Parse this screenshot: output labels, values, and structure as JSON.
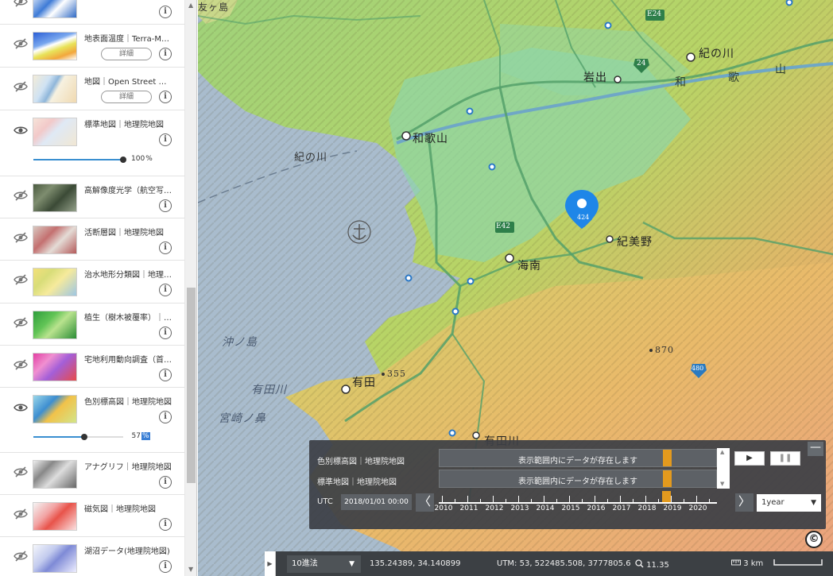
{
  "layers": [
    {
      "name": "",
      "visible": false,
      "detail_button": "",
      "has_slider": false
    },
    {
      "name": "地表面温度｜Terra-MODIS",
      "visible": false,
      "detail_button": "詳細",
      "has_slider": false
    },
    {
      "name": "地図｜Open Street Map",
      "visible": false,
      "detail_button": "詳細",
      "has_slider": false
    },
    {
      "name": "標準地図｜地理院地図",
      "visible": true,
      "detail_button": "",
      "has_slider": true,
      "opacity": "100",
      "opacity_unit": "%"
    },
    {
      "name": "高解像度光学（航空写真）",
      "visible": false,
      "detail_button": "",
      "has_slider": false
    },
    {
      "name": "活断層図｜地理院地図",
      "visible": false,
      "detail_button": "",
      "has_slider": false
    },
    {
      "name": "治水地形分類図｜地理院地図",
      "visible": false,
      "detail_button": "",
      "has_slider": false
    },
    {
      "name": "植生（樹木被覆率）｜…",
      "visible": false,
      "detail_button": "",
      "has_slider": false
    },
    {
      "name": "宅地利用動向調査（首都圏）",
      "visible": false,
      "detail_button": "",
      "has_slider": false
    },
    {
      "name": "色別標高図｜地理院地図",
      "visible": true,
      "detail_button": "",
      "has_slider": true,
      "opacity": "57",
      "opacity_unit": "%"
    },
    {
      "name": "アナグリフ｜地理院地図",
      "visible": false,
      "detail_button": "",
      "has_slider": false
    },
    {
      "name": "磁気図｜地理院地図",
      "visible": false,
      "detail_button": "",
      "has_slider": false
    },
    {
      "name": "湖沼データ(地理院地図)",
      "visible": false,
      "detail_button": "",
      "has_slider": false
    }
  ],
  "map": {
    "labels": {
      "kinokawa_sea": "紀の川",
      "wakayama": "和歌山",
      "iwade": "岩出",
      "kinokawa_city": "紀の川",
      "kimino": "紀美野",
      "kainan": "海南",
      "okinoshima": "沖ノ島",
      "aridagawa": "有田川",
      "arida": "有田",
      "miyazakinohana": "宮崎ノ鼻",
      "peak355": "355",
      "peak870": "870",
      "wa": "和",
      "ka": "歌",
      "yama": "山",
      "tomogashima": "友ヶ島",
      "e42": "E42",
      "e24": "E24",
      "r24": "24",
      "r424": "424",
      "r480": "480",
      "arida_bottom": "有田川"
    }
  },
  "timeline": {
    "rows": [
      {
        "name": "色別標高図｜地理院地図",
        "status": "表示範囲内にデータが存在します"
      },
      {
        "name": "標準地図｜地理院地図",
        "status": "表示範囲内にデータが存在します"
      }
    ],
    "play_label": "▶",
    "pause_label": "❚❚",
    "minimize_label": "—",
    "utc_label": "UTC",
    "current_time": "2018/01/01 00:00",
    "prev_label": "〈",
    "next_label": "〉",
    "years": [
      "2010",
      "2011",
      "2012",
      "2013",
      "2014",
      "2015",
      "2016",
      "2017",
      "2018",
      "2019",
      "2020"
    ],
    "current_year": "2018",
    "interval": "1year"
  },
  "status_bar": {
    "projection": "10進法",
    "lonlat": "135.24389, 34.140899",
    "utm": "UTM: 53, 522485.508, 3777805.6",
    "zoom": "11.35",
    "scale": "3 km"
  },
  "copyright_symbol": "©"
}
